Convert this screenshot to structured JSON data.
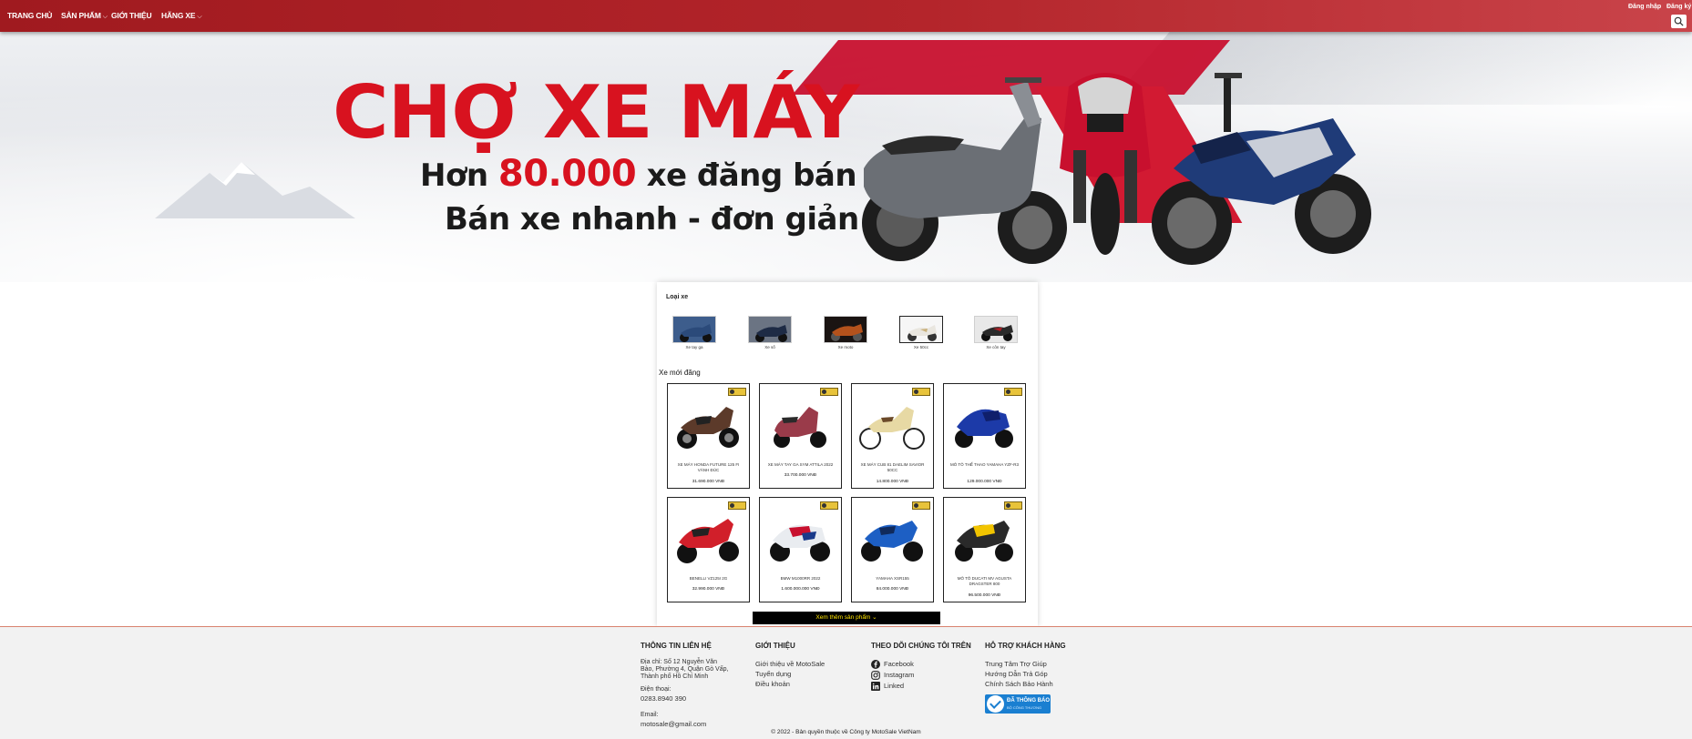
{
  "nav": {
    "items": [
      {
        "label": "TRANG CHỦ",
        "caret": false
      },
      {
        "label": "SẢN PHẨM",
        "caret": true
      },
      {
        "label": "GIỚI THIỆU",
        "caret": false
      },
      {
        "label": "HÃNG XE",
        "caret": true
      }
    ],
    "login_label": "Đăng nhập",
    "register_label": "Đăng ký",
    "search_icon": "search-icon"
  },
  "banner": {
    "title": "CHỢ XE MÁY",
    "line1_prefix": "Hơn",
    "line1_highlight": "80.000",
    "line1_suffix": "xe đăng bán",
    "line2": "Bán xe nhanh - đơn giản",
    "accent_color": "#d8121f"
  },
  "categories": {
    "title": "Loại xe",
    "items": [
      {
        "label": "Xe tay ga"
      },
      {
        "label": "Xe số"
      },
      {
        "label": "Xe moto"
      },
      {
        "label": "Xe 50cc"
      },
      {
        "label": "Xe côn tay"
      }
    ]
  },
  "new_listings": {
    "title": "Xe mới đăng",
    "products": [
      {
        "name": "XE MÁY HONDA FUTURE 125 FI VÀNH ĐÚC",
        "price": "31.690.000 VNĐ"
      },
      {
        "name": "XE MÁY TAY GA SYM ATTILA 2022",
        "price": "33.700.000 VNĐ"
      },
      {
        "name": "XE MÁY CUB 81 DAELIM SAVIOR 50CC",
        "price": "14.800.000 VNĐ"
      },
      {
        "name": "MÔ TÔ THỂ THAO YAMAHA YZF-R3",
        "price": "129.000.000 VNĐ"
      },
      {
        "name": "BENELLI VZ125i 2G",
        "price": "32.990.000 VNĐ"
      },
      {
        "name": "BMW M1000RR 2022",
        "price": "1.600.000.000 VNĐ"
      },
      {
        "name": "YAMAHA XSR155",
        "price": "84.000.000 VNĐ"
      },
      {
        "name": "MÔ TÔ DUCATI MV AGUSTA DRAGSTER 800",
        "price": "96.500.000 VNĐ"
      }
    ],
    "more_button": "Xem thêm sản phẩm"
  },
  "footer": {
    "contact": {
      "title": "THÔNG TIN LIÊN HỆ",
      "address": "Địa chỉ: Số 12 Nguyễn Văn Bảo, Phường 4, Quận Gò Vấp, Thành phố Hồ Chí Minh",
      "phone_label": "Điện thoại:",
      "phone": "0283.8940 390",
      "email_label": "Email:",
      "email": "motosale@gmail.com"
    },
    "about": {
      "title": "GIỚI THIỆU",
      "links": [
        "Giới thiệu về MotoSale",
        "Tuyển dụng",
        "Điều khoản"
      ]
    },
    "follow": {
      "title": "THEO DÕI CHÚNG TÔI TRÊN",
      "links": [
        {
          "label": "Facebook",
          "icon": "facebook-icon"
        },
        {
          "label": "Instagram",
          "icon": "instagram-icon"
        },
        {
          "label": "Linked",
          "icon": "linkedin-icon"
        }
      ]
    },
    "support": {
      "title": "HỖ TRỢ KHÁCH HÀNG",
      "links": [
        "Trung Tâm Trợ Giúp",
        "Hướng Dẫn Trả Góp",
        "Chính Sách Bảo Hành"
      ],
      "badge_line1": "ĐÃ THÔNG BÁO",
      "badge_line2": "BỘ CÔNG THƯƠNG"
    },
    "copyright": "© 2022 - Bản quyền thuộc về Công ty MotoSale VietNam"
  }
}
